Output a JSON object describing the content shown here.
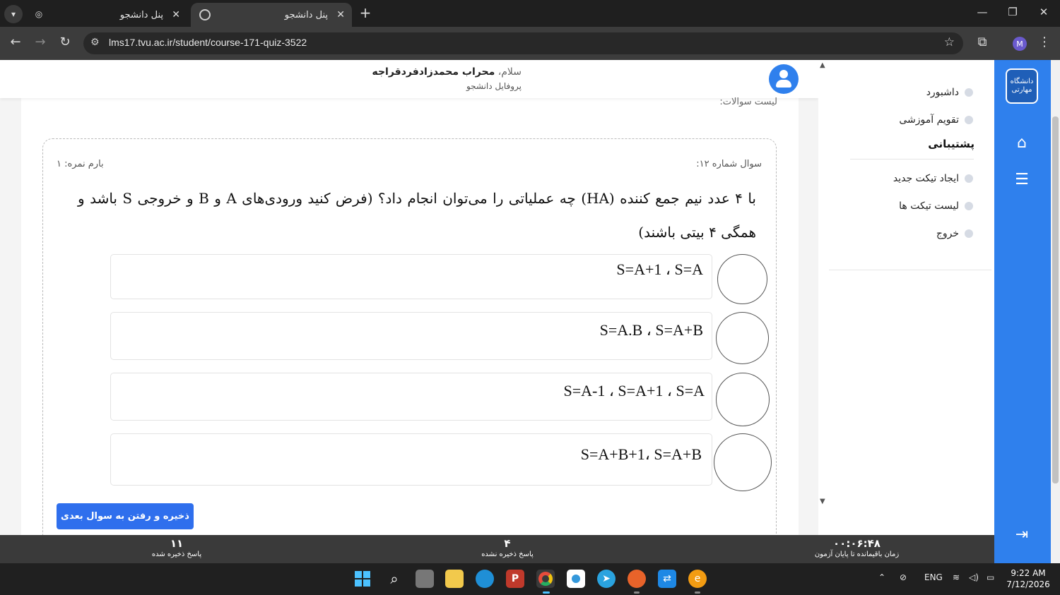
{
  "browser": {
    "tabs": [
      {
        "title": "پنل دانشجو",
        "active": false
      },
      {
        "title": "پنل دانشجو",
        "active": true
      }
    ],
    "url": "lms17.tvu.ac.ir/student/course-171-quiz-3522",
    "profile_initial": "M"
  },
  "header": {
    "greeting_prefix": "سلام، ",
    "user_name": "محراب محمدزادفردقراجه",
    "profile_link": "پروفایل دانشجو",
    "question_list_label": "لیست سوالات:"
  },
  "question": {
    "number_label": "سوال شماره ۱۲:",
    "score_label": "بارم نمره: ۱",
    "text": "با ۴ عدد نیم جمع کننده (HA) چه عملیاتی را می‌توان انجام داد؟ (فرض کنید ورودی‌های A و B و خروجی S باشد و همگی ۴ بیتی باشند)",
    "options": [
      {
        "text": "S=A+1 ، S=A"
      },
      {
        "text": "S=A.B ، S=A+B"
      },
      {
        "text": "S=A-1 ، S=A+1 ، S=A"
      },
      {
        "text": "S=A+B+1، S=A+B"
      }
    ],
    "next_button": "ذخیره و رفتن به سوال بعدی"
  },
  "sidebar": {
    "items_top": [
      {
        "label": "داشبورد"
      },
      {
        "label": "تقویم آموزشی"
      }
    ],
    "support_heading": "پشتیبانی",
    "items_support": [
      {
        "label": "ایجاد تیکت جدید"
      },
      {
        "label": "لیست تیکت ها"
      },
      {
        "label": "خروج"
      }
    ],
    "logo_text": "دانشگاه مهارتی"
  },
  "status": {
    "saved_count": "۱۱",
    "saved_label": "پاسخ ذخیره شده",
    "unsaved_count": "۴",
    "unsaved_label": "پاسخ ذخیره نشده",
    "time_remaining": "۰۰:۰۶:۴۸",
    "time_label": "زمان باقیمانده تا پایان آزمون"
  },
  "taskbar": {
    "lang": "ENG",
    "time": "9:22 AM",
    "date": "7/12/2026"
  },
  "colors": {
    "primary": "#2f80ed",
    "button": "#2f6fed",
    "statusbar": "#3a3a3a"
  }
}
